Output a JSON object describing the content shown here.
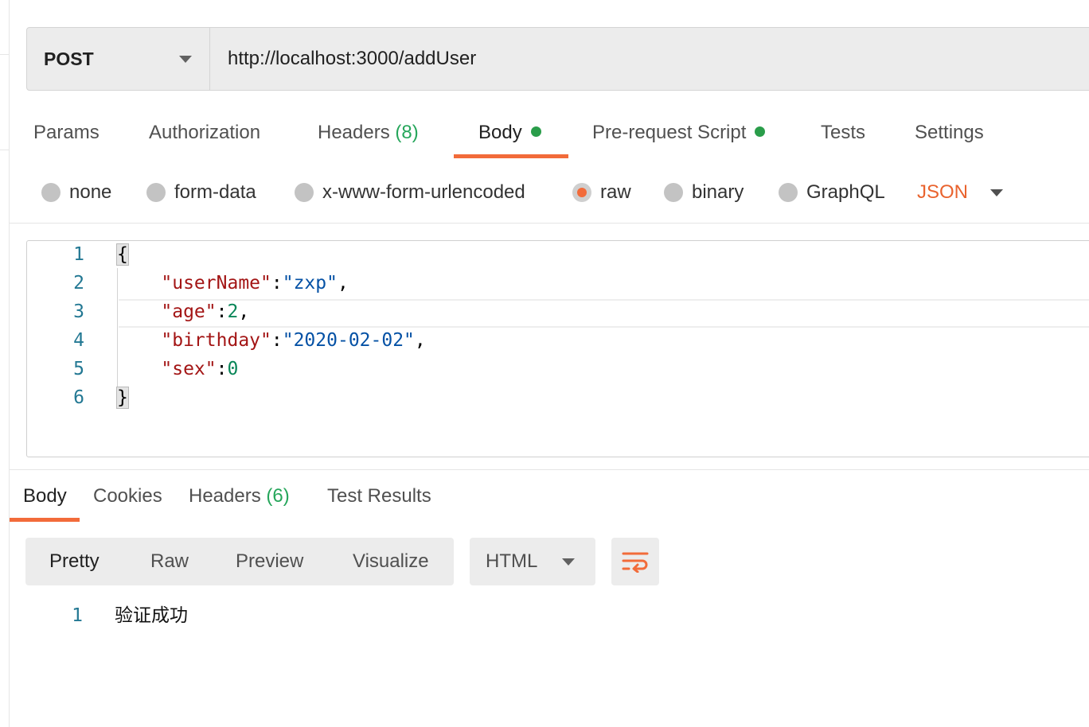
{
  "request": {
    "method": "POST",
    "url": "http://localhost:3000/addUser"
  },
  "request_tabs": [
    {
      "label": "Params"
    },
    {
      "label": "Authorization"
    },
    {
      "label": "Headers",
      "count": "(8)"
    },
    {
      "label": "Body",
      "active": true,
      "indicator": "green-dot"
    },
    {
      "label": "Pre-request Script",
      "indicator": "green-dot"
    },
    {
      "label": "Tests"
    },
    {
      "label": "Settings"
    }
  ],
  "body_types": [
    {
      "label": "none"
    },
    {
      "label": "form-data"
    },
    {
      "label": "x-www-form-urlencoded"
    },
    {
      "label": "raw",
      "selected": true
    },
    {
      "label": "binary"
    },
    {
      "label": "GraphQL"
    }
  ],
  "raw_format": "JSON",
  "editor": {
    "line_numbers": [
      "1",
      "2",
      "3",
      "4",
      "5",
      "6"
    ],
    "lines": [
      {
        "tokens": [
          {
            "t": "{",
            "c": "p"
          }
        ]
      },
      {
        "tokens": [
          {
            "t": "    ",
            "c": "p"
          },
          {
            "t": "\"userName\"",
            "c": "k"
          },
          {
            "t": ":",
            "c": "p"
          },
          {
            "t": "\"zxp\"",
            "c": "s"
          },
          {
            "t": ",",
            "c": "p"
          }
        ]
      },
      {
        "tokens": [
          {
            "t": "    ",
            "c": "p"
          },
          {
            "t": "\"age\"",
            "c": "k"
          },
          {
            "t": ":",
            "c": "p"
          },
          {
            "t": "2",
            "c": "n"
          },
          {
            "t": ",",
            "c": "p"
          }
        ]
      },
      {
        "tokens": [
          {
            "t": "    ",
            "c": "p"
          },
          {
            "t": "\"birthday\"",
            "c": "k"
          },
          {
            "t": ":",
            "c": "p"
          },
          {
            "t": "\"2020-02-02\"",
            "c": "s"
          },
          {
            "t": ",",
            "c": "p"
          }
        ]
      },
      {
        "tokens": [
          {
            "t": "    ",
            "c": "p"
          },
          {
            "t": "\"sex\"",
            "c": "k"
          },
          {
            "t": ":",
            "c": "p"
          },
          {
            "t": "0",
            "c": "n"
          }
        ]
      },
      {
        "tokens": [
          {
            "t": "}",
            "c": "p"
          }
        ]
      }
    ]
  },
  "response_tabs": [
    {
      "label": "Body",
      "active": true
    },
    {
      "label": "Cookies"
    },
    {
      "label": "Headers",
      "count": "(6)"
    },
    {
      "label": "Test Results"
    }
  ],
  "view_modes": [
    {
      "label": "Pretty",
      "active": true
    },
    {
      "label": "Raw"
    },
    {
      "label": "Preview"
    },
    {
      "label": "Visualize"
    }
  ],
  "response_format": "HTML",
  "wrap_icon": "wrap-lines-icon",
  "response_body": {
    "line_number": "1",
    "text": "验证成功"
  },
  "colors": {
    "accent": "#f26b3a",
    "json_accent": "#e9632e",
    "indicator_green": "#2a9d4a",
    "count_green": "#26a65b",
    "line_number": "#237893",
    "json_key": "#a31515",
    "json_string": "#0451a5",
    "json_number": "#098658"
  }
}
